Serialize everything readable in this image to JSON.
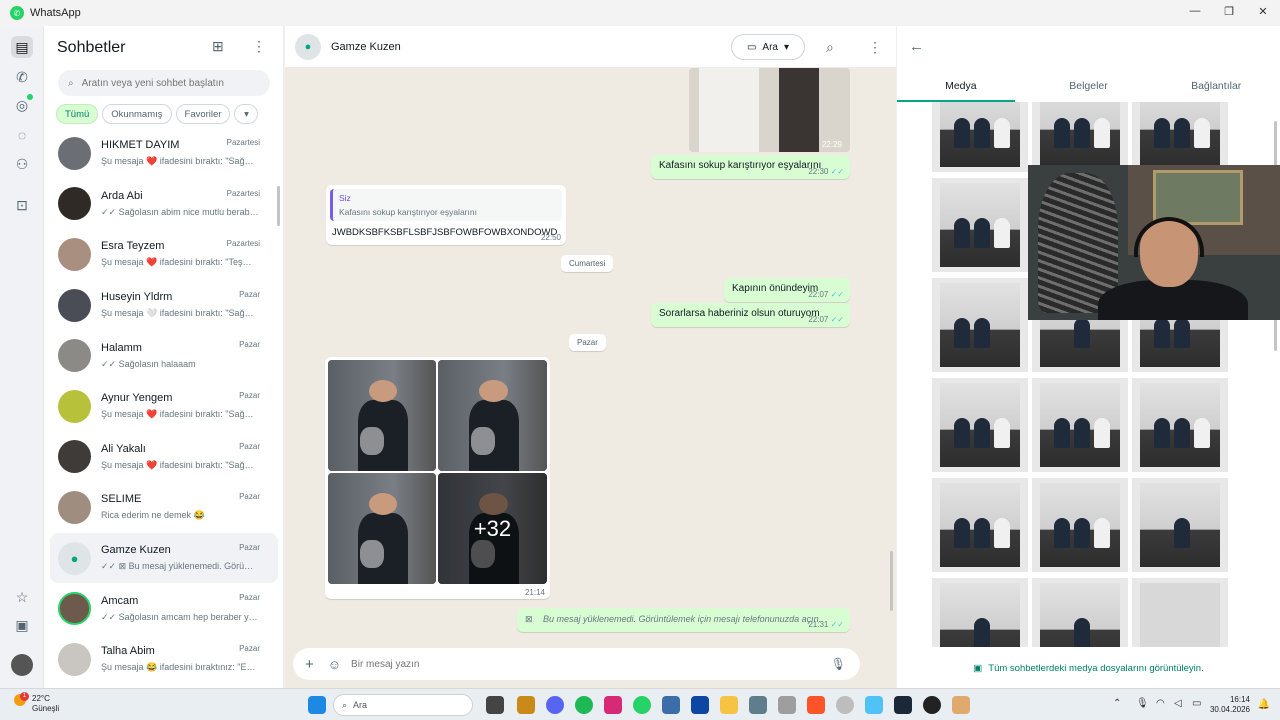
{
  "titlebar": {
    "title": "WhatsApp",
    "controls": [
      "—",
      "❐",
      "✕"
    ]
  },
  "chatlist": {
    "title": "Sohbetler",
    "search_placeholder": "Aratın veya yeni sohbet başlatın",
    "filters": [
      "Tümü",
      "Okunmamış",
      "Favoriler",
      "▾"
    ],
    "items": [
      {
        "name": "HIKMET DAYIM",
        "date": "Pazartesi",
        "preview": "Şu mesaja ❤️ ifadesini bıraktı: \"Sağ…"
      },
      {
        "name": "Arda Abi",
        "date": "Pazartesi",
        "preview": "✓✓ Sağolasın abim nice mutlu berab…"
      },
      {
        "name": "Esra Teyzem",
        "date": "Pazartesi",
        "preview": "Şu mesaja ❤️ ifadesini bıraktı: \"Teş…"
      },
      {
        "name": "Huseyin Yldrm",
        "date": "Pazar",
        "preview": "Şu mesaja 🤍 ifadesini bıraktı: \"Sağ…"
      },
      {
        "name": "Halamm",
        "date": "Pazar",
        "preview": "✓✓ Sağolasın halaaam"
      },
      {
        "name": "Aynur Yengem",
        "date": "Pazar",
        "preview": "Şu mesaja ❤️ ifadesini bıraktı: \"Sağ…"
      },
      {
        "name": "Ali Yakalı",
        "date": "Pazar",
        "preview": "Şu mesaja ❤️ ifadesini bıraktı: \"Sağ…"
      },
      {
        "name": "SELIME",
        "date": "Pazar",
        "preview": "Rica ederim ne demek 😂"
      },
      {
        "name": "Gamze Kuzen",
        "date": "Pazar",
        "preview": "✓✓ ⊠ Bu mesaj yüklenemedi. Görü…"
      },
      {
        "name": "Amcam",
        "date": "Pazar",
        "preview": "✓✓ Sağolasın amcam hep beraber y…"
      },
      {
        "name": "Talha Abim",
        "date": "Pazar",
        "preview": "Şu mesaja 😂 ifadesini bıraktınız: \"E…"
      }
    ]
  },
  "chat": {
    "contact": "Gamze Kuzen",
    "call_label": "Ara",
    "messages": {
      "photo_time": "22:29",
      "m1_text": "Kafasını sokup karıştırıyor eşyalarını",
      "m1_time": "22:30",
      "reply_author": "Siz",
      "reply_quote": "Kafasını sokup karıştırıyor eşyalarını",
      "m2_text": "JWBDKSBFKSBFLSBFJSBFOWBFOWBXONDOWD",
      "m2_time": "22:50",
      "day1": "Cumartesi",
      "m3_text": "Kapının önündeyim",
      "m3_time": "22:07",
      "m4_text": "Sorarlarsa haberiniz olsun oturuyom",
      "m4_time": "22:07",
      "day2": "Pazar",
      "album_more": "+32",
      "album_time": "21:14",
      "failed_text": "Bu mesaj yüklenemedi. Görüntülemek için mesajı telefonunuzda açın.",
      "failed_time": "21:31"
    },
    "composer_placeholder": "Bir mesaj yazın"
  },
  "media_panel": {
    "tabs": [
      "Medya",
      "Belgeler",
      "Bağlantılar"
    ],
    "footer": "Tüm sohbetlerdeki medya dosyalarını görüntüleyin."
  },
  "taskbar": {
    "temp": "22°C",
    "weather": "Güneşli",
    "weather_badge": "1",
    "search_placeholder": "Ara",
    "time": "16:14",
    "date": "30.04.2026"
  },
  "colors": {
    "accent": "#00a884",
    "outgoing": "#d9fdd3",
    "chat_bg": "#efeae2",
    "read_tick": "#53bdeb"
  }
}
